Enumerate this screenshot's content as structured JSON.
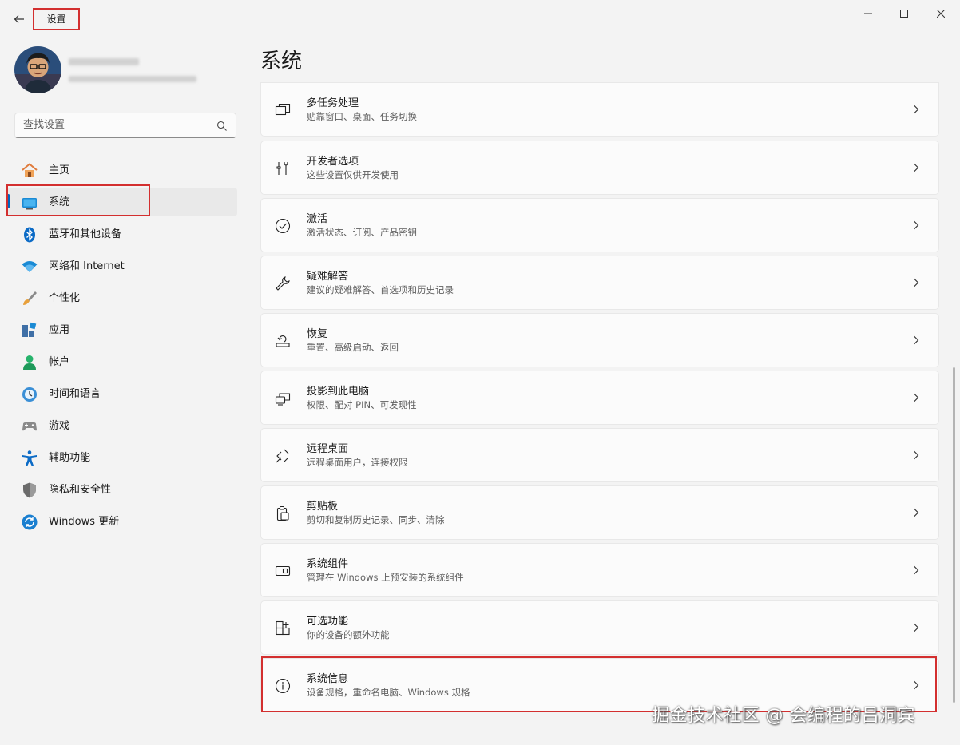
{
  "window": {
    "title": "设置"
  },
  "search": {
    "placeholder": "查找设置"
  },
  "nav": [
    {
      "label": "主页",
      "icon": "home-icon"
    },
    {
      "label": "系统",
      "icon": "display-icon"
    },
    {
      "label": "蓝牙和其他设备",
      "icon": "bluetooth-icon"
    },
    {
      "label": "网络和 Internet",
      "icon": "wifi-icon"
    },
    {
      "label": "个性化",
      "icon": "brush-icon"
    },
    {
      "label": "应用",
      "icon": "apps-icon"
    },
    {
      "label": "帐户",
      "icon": "user-icon"
    },
    {
      "label": "时间和语言",
      "icon": "clock-globe-icon"
    },
    {
      "label": "游戏",
      "icon": "gamepad-icon"
    },
    {
      "label": "辅助功能",
      "icon": "accessibility-icon"
    },
    {
      "label": "隐私和安全性",
      "icon": "shield-icon"
    },
    {
      "label": "Windows 更新",
      "icon": "update-icon"
    }
  ],
  "main": {
    "title": "系统",
    "cards": [
      {
        "title": "多任务处理",
        "subtitle": "贴靠窗口、桌面、任务切换",
        "icon": "multitask-icon"
      },
      {
        "title": "开发者选项",
        "subtitle": "这些设置仅供开发使用",
        "icon": "developer-tools-icon"
      },
      {
        "title": "激活",
        "subtitle": "激活状态、订阅、产品密钥",
        "icon": "check-circle-icon"
      },
      {
        "title": "疑难解答",
        "subtitle": "建议的疑难解答、首选项和历史记录",
        "icon": "wrench-icon"
      },
      {
        "title": "恢复",
        "subtitle": "重置、高级启动、返回",
        "icon": "recovery-icon"
      },
      {
        "title": "投影到此电脑",
        "subtitle": "权限、配对 PIN、可发现性",
        "icon": "project-icon"
      },
      {
        "title": "远程桌面",
        "subtitle": "远程桌面用户，连接权限",
        "icon": "remote-desktop-icon"
      },
      {
        "title": "剪贴板",
        "subtitle": "剪切和复制历史记录、同步、清除",
        "icon": "clipboard-icon"
      },
      {
        "title": "系统组件",
        "subtitle": "管理在 Windows 上预安装的系统组件",
        "icon": "system-components-icon"
      },
      {
        "title": "可选功能",
        "subtitle": "你的设备的额外功能",
        "icon": "add-features-icon"
      },
      {
        "title": "系统信息",
        "subtitle": "设备规格，重命名电脑、Windows 规格",
        "icon": "info-icon"
      }
    ]
  },
  "watermark": "掘金技术社区 @ 会编程的吕洞宾",
  "colors": {
    "accent": "#0067c0",
    "highlight": "#d32f2f"
  }
}
